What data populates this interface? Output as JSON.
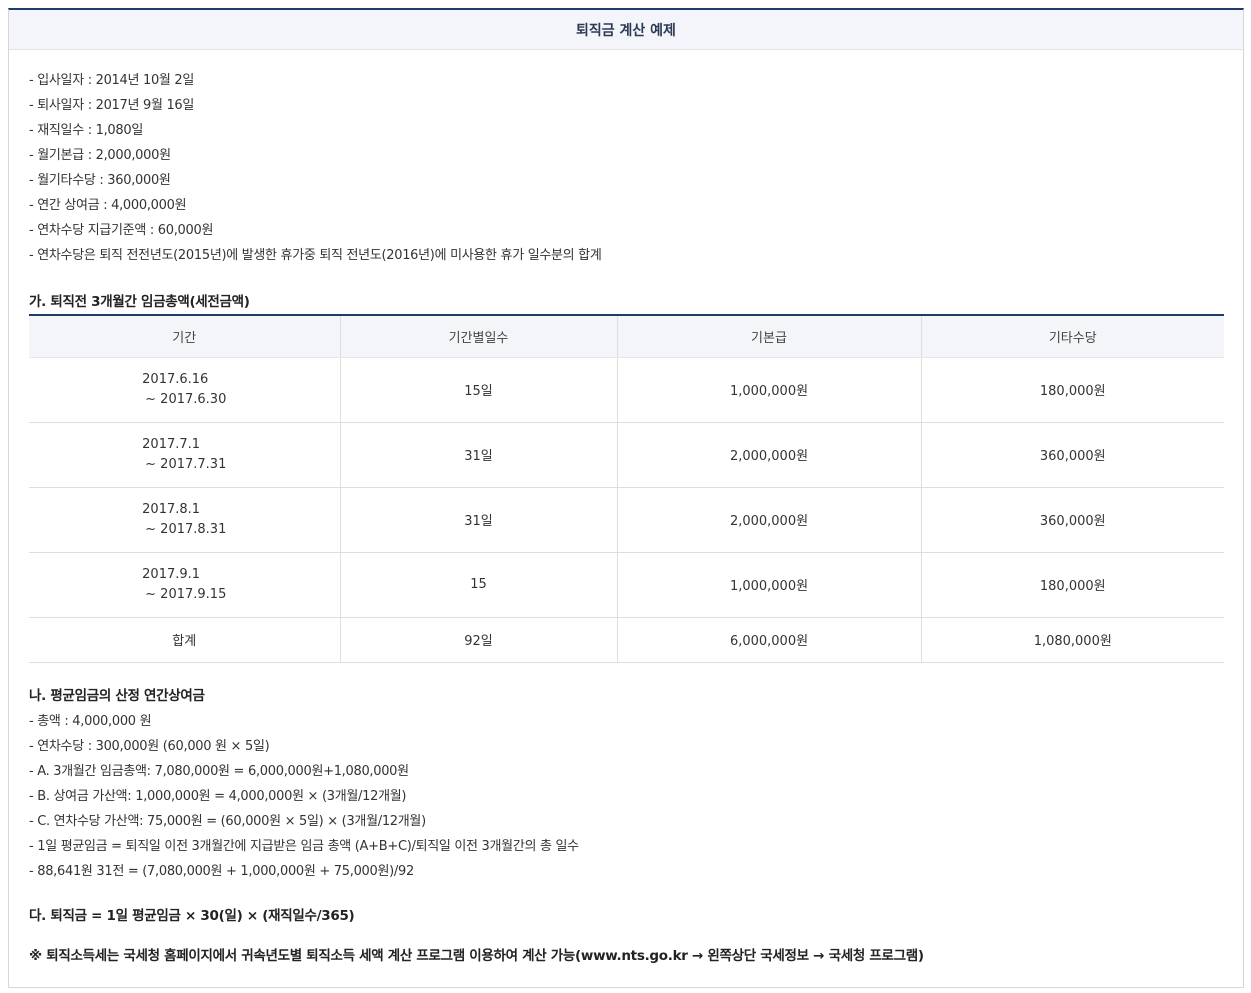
{
  "header": {
    "title": "퇴직금 계산 예제"
  },
  "info_items": [
    "입사일자 : 2014년 10월 2일",
    "퇴사일자 : 2017년 9월 16일",
    "재직일수 : 1,080일",
    "월기본급 : 2,000,000원",
    "월기타수당 : 360,000원",
    "연간 상여금 : 4,000,000원",
    "연차수당 지급기준액 : 60,000원",
    "연차수당은 퇴직 전전년도(2015년)에 발생한 휴가중 퇴직 전년도(2016년)에 미사용한 휴가 일수분의 합계"
  ],
  "section_ga": {
    "title": "가. 퇴직전 3개월간 임금총액(세전금액)",
    "columns": [
      "기간",
      "기간별일수",
      "기본급",
      "기타수당"
    ],
    "rows": [
      {
        "period_start": "2017.6.16",
        "period_end": "~ 2017.6.30",
        "days": "15일",
        "base": "1,000,000원",
        "other": "180,000원"
      },
      {
        "period_start": "2017.7.1",
        "period_end": "~ 2017.7.31",
        "days": "31일",
        "base": "2,000,000원",
        "other": "360,000원"
      },
      {
        "period_start": "2017.8.1",
        "period_end": "~ 2017.8.31",
        "days": "31일",
        "base": "2,000,000원",
        "other": "360,000원"
      },
      {
        "period_start": "2017.9.1",
        "period_end": "~ 2017.9.15",
        "days": "15",
        "base": "1,000,000원",
        "other": "180,000원"
      }
    ],
    "total": {
      "label": "합계",
      "days": "92일",
      "base": "6,000,000원",
      "other": "1,080,000원"
    }
  },
  "section_na": {
    "title": "나. 평균임금의 산정 연간상여금",
    "items": [
      "총액 : 4,000,000 원",
      "연차수당 : 300,000원 (60,000 원 × 5일)",
      "A. 3개월간 임금총액: 7,080,000원 = 6,000,000원+1,080,000원",
      "B. 상여금 가산액: 1,000,000원 = 4,000,000원 × (3개월/12개월)",
      "C. 연차수당 가산액: 75,000원 = (60,000원 × 5일) × (3개월/12개월)",
      "1일 평균임금 = 퇴직일 이전 3개월간에 지급받은 임금 총액 (A+B+C)/퇴직일 이전 3개월간의 총 일수",
      "88,641원 31전 = (7,080,000원 + 1,000,000원 + 75,000원)/92"
    ]
  },
  "section_da": {
    "formula": "다. 퇴직금 = 1일 평균임금 × 30(일) × (재직일수/365)"
  },
  "note": "※ 퇴직소득세는 국세청 홈페이지에서 귀속년도별 퇴직소득 세액 계산 프로그램 이용하여 계산 가능(www.nts.go.kr → 왼쪽상단 국세정보 → 국세청 프로그램)"
}
